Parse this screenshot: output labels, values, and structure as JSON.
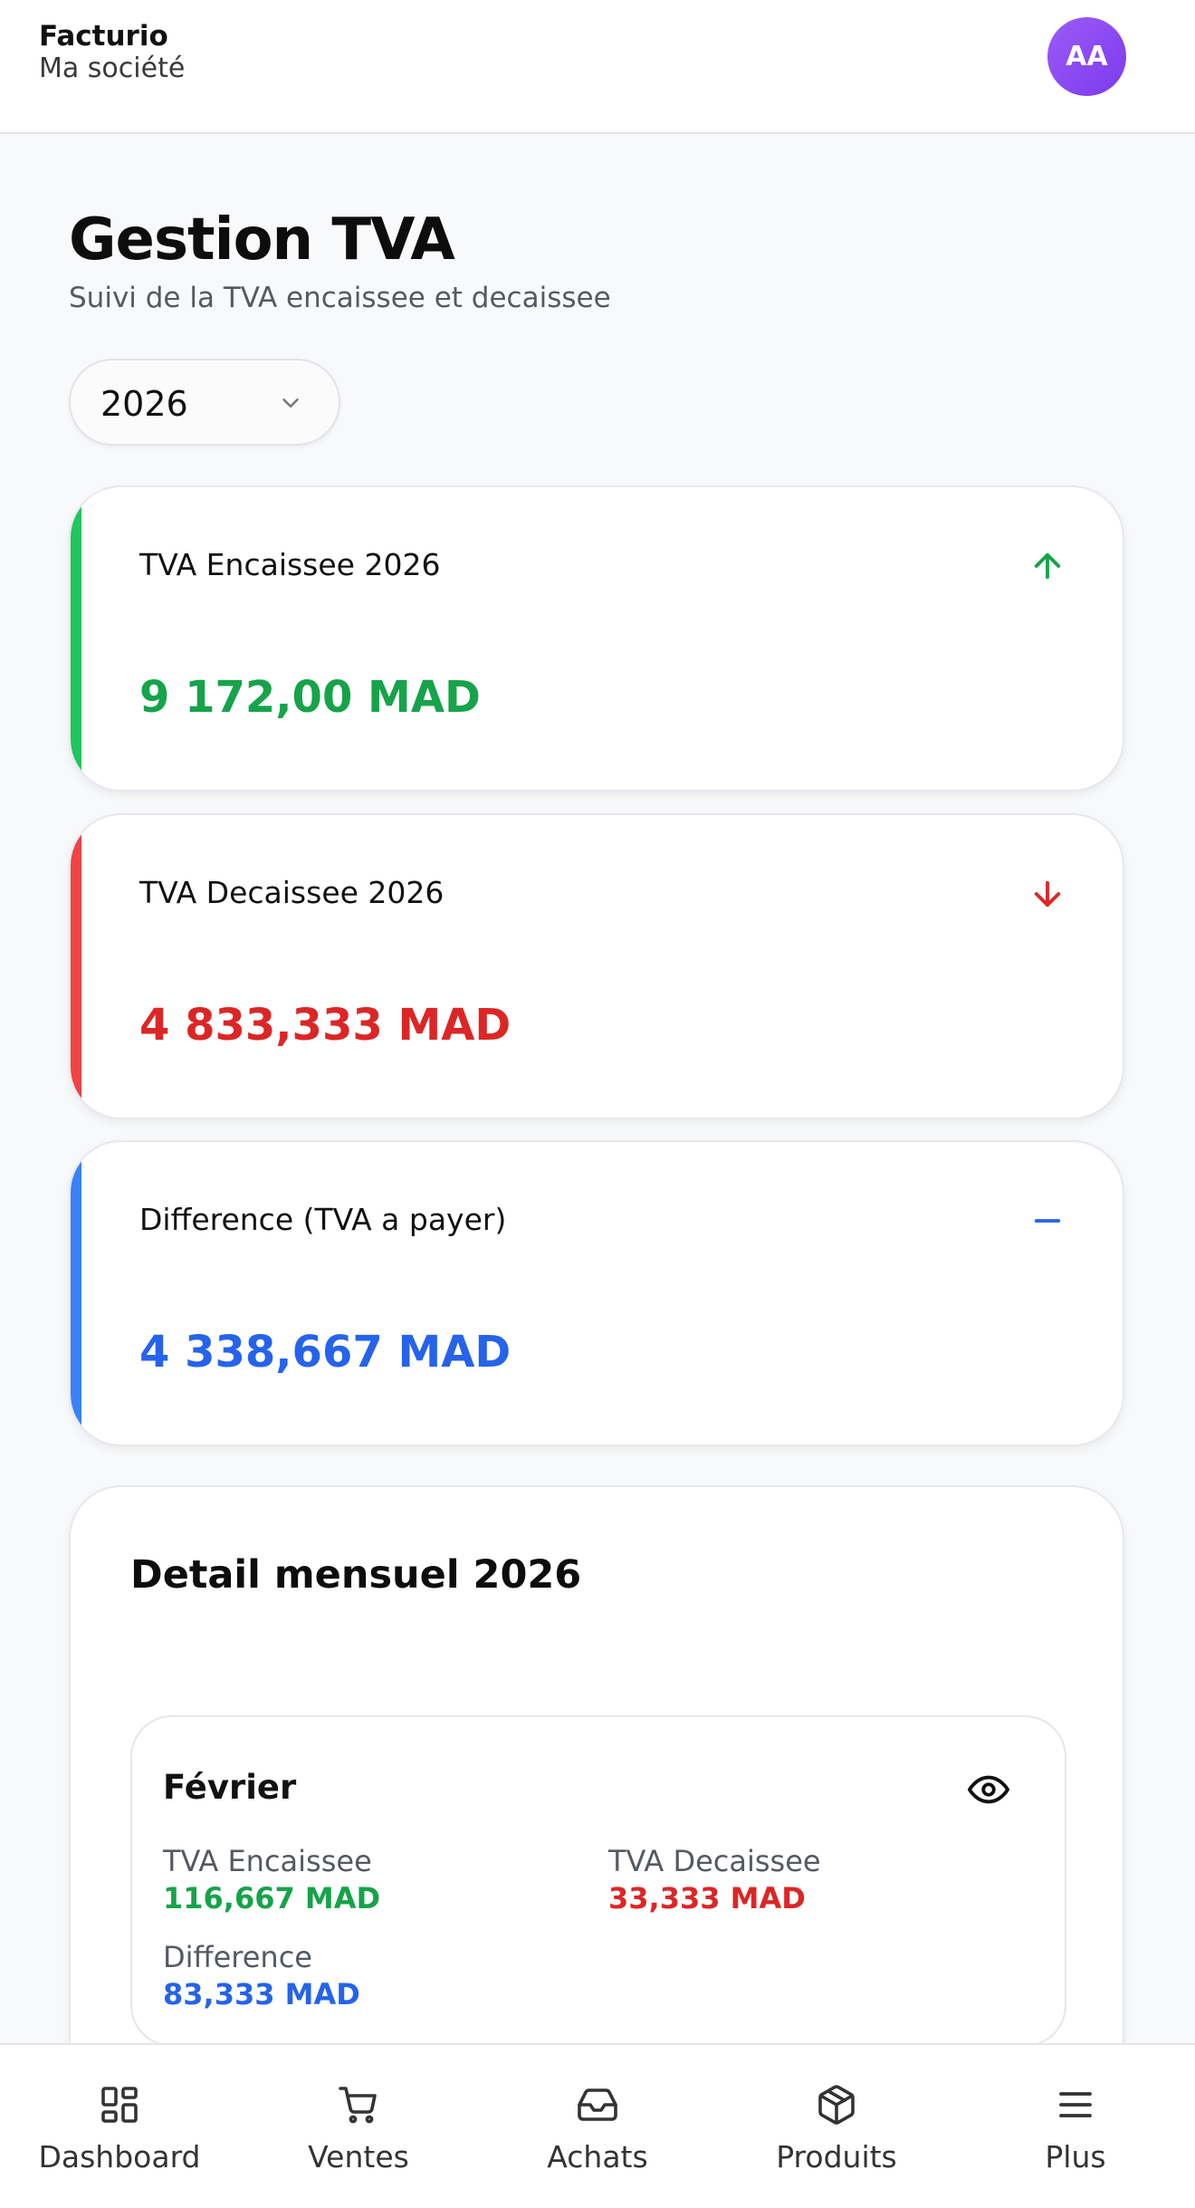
{
  "header": {
    "brand": "Facturio",
    "company": "Ma société",
    "avatar_initials": "AA"
  },
  "page": {
    "title": "Gestion TVA",
    "subtitle": "Suivi de la TVA encaissee et decaissee"
  },
  "year_select": {
    "value": "2026"
  },
  "stats": [
    {
      "label": "TVA Encaissee 2026",
      "value": "9 172,00 MAD",
      "icon": "arrow-up-icon",
      "color": "#16a34a"
    },
    {
      "label": "TVA Decaissee 2026",
      "value": "4 833,333 MAD",
      "icon": "arrow-down-icon",
      "color": "#dc2626"
    },
    {
      "label": "Difference (TVA a payer)",
      "value": "4 338,667 MAD",
      "icon": "minus-icon",
      "color": "#2563eb"
    }
  ],
  "monthly": {
    "title": "Detail mensuel 2026",
    "months": [
      {
        "name": "Février",
        "encaissee_label": "TVA Encaissee",
        "encaissee_value": "116,667 MAD",
        "decaissee_label": "TVA Decaissee",
        "decaissee_value": "33,333 MAD",
        "difference_label": "Difference",
        "difference_value": "83,333 MAD"
      }
    ]
  },
  "nav": [
    {
      "label": "Dashboard",
      "icon": "dashboard-icon"
    },
    {
      "label": "Ventes",
      "icon": "cart-icon"
    },
    {
      "label": "Achats",
      "icon": "inbox-icon"
    },
    {
      "label": "Produits",
      "icon": "package-icon"
    },
    {
      "label": "Plus",
      "icon": "menu-icon"
    }
  ],
  "colors": {
    "accent_purple": "#7c3aed",
    "green": "#16a34a",
    "red": "#dc2626",
    "blue": "#2563eb"
  }
}
